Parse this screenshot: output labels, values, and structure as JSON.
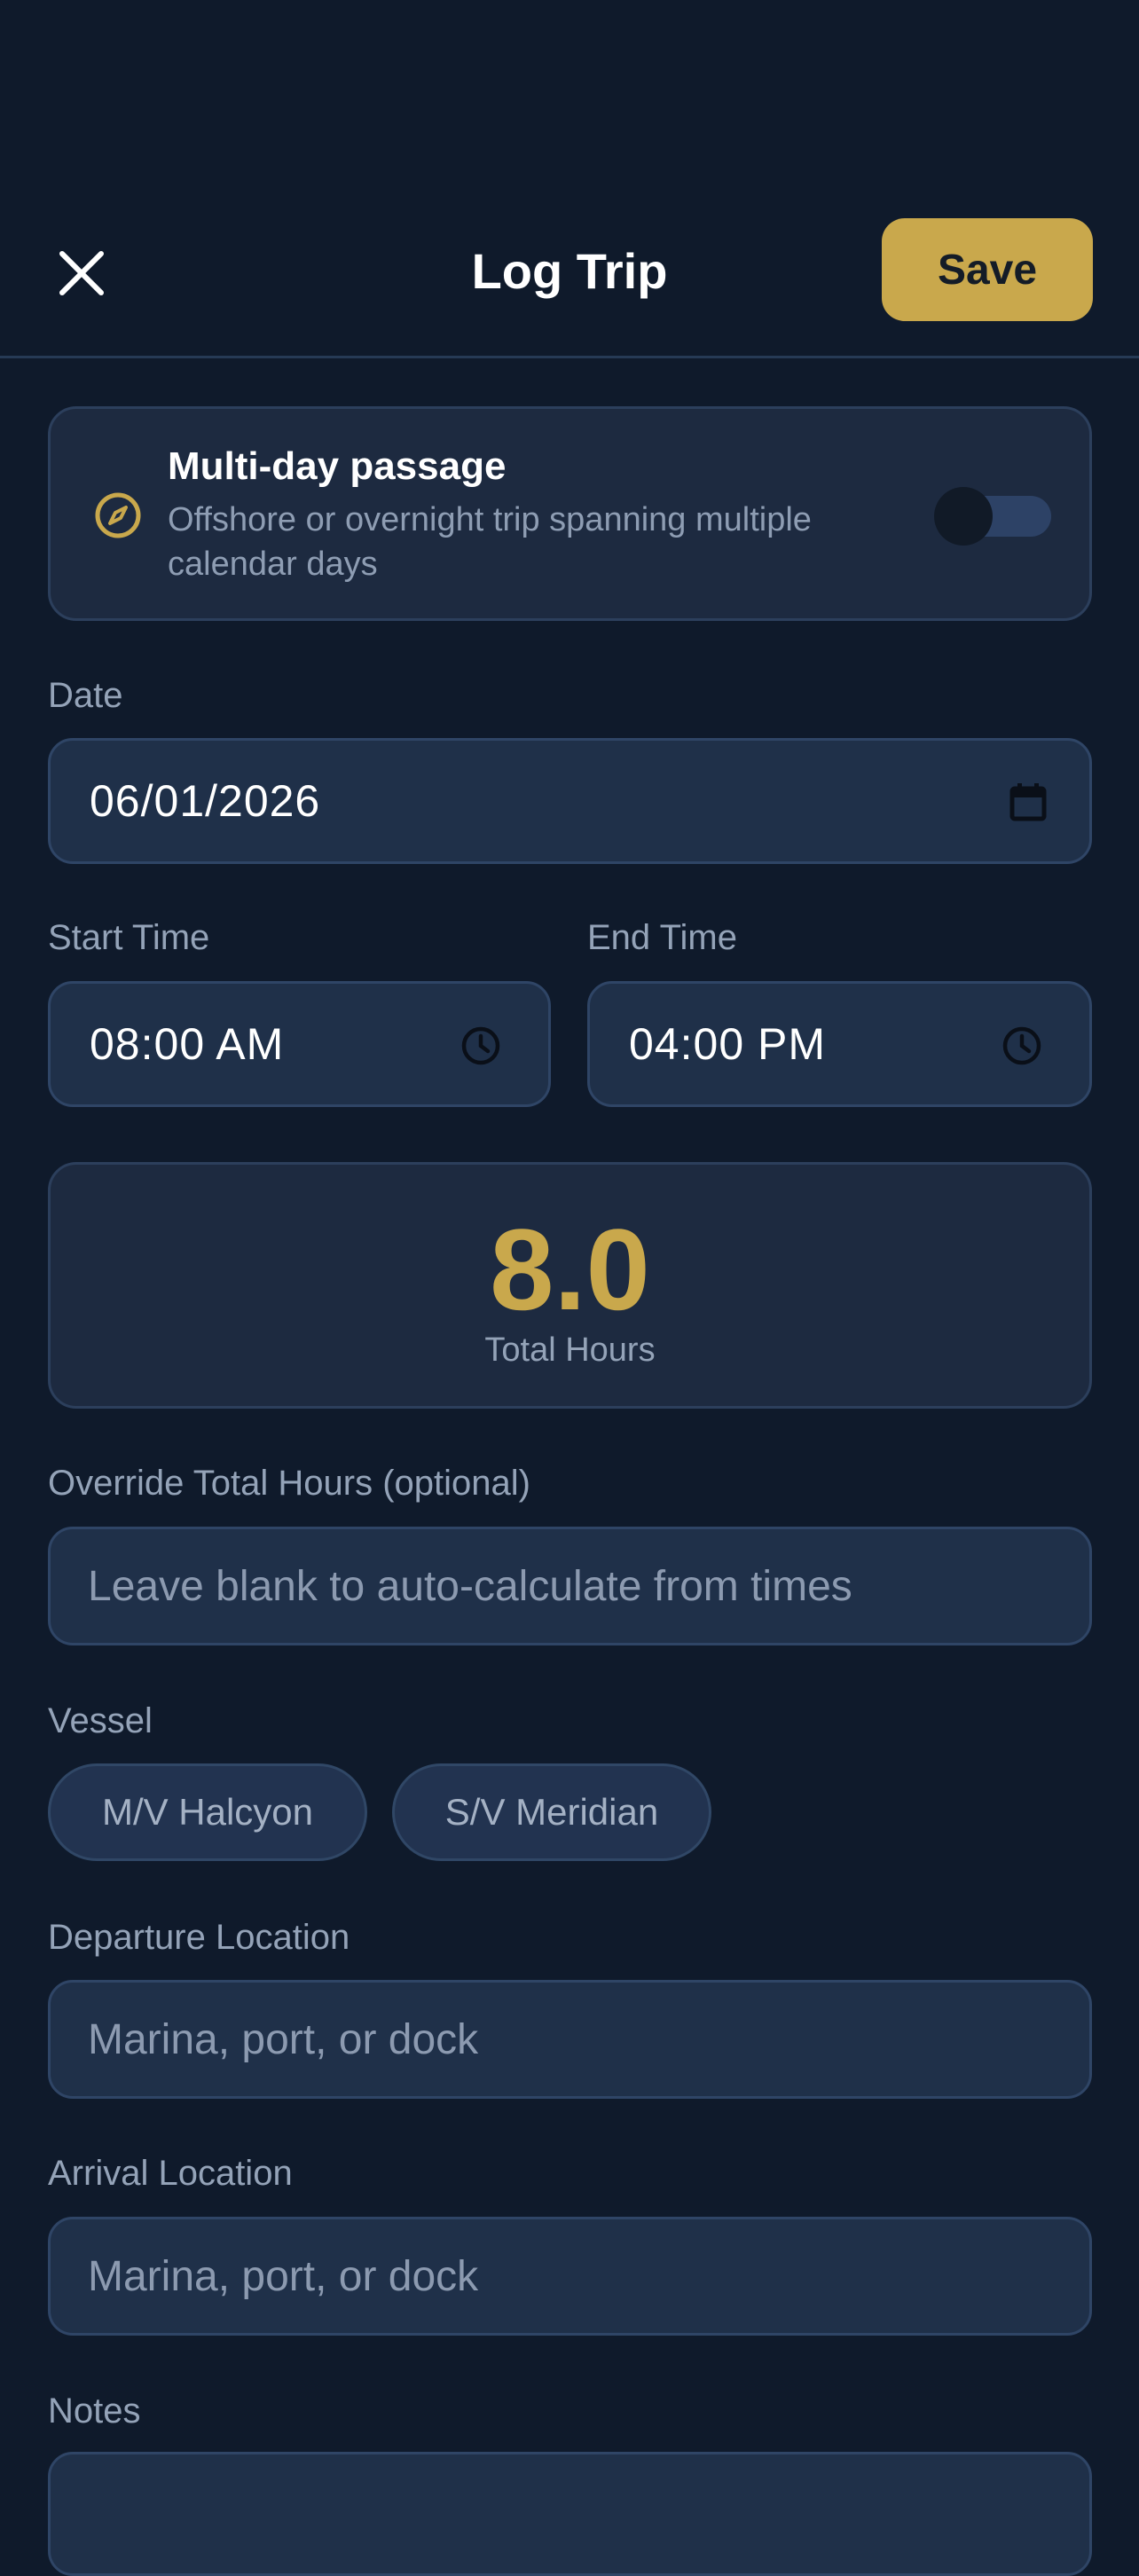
{
  "header": {
    "title": "Log Trip",
    "save_label": "Save",
    "close_icon": "close-icon"
  },
  "passage": {
    "title": "Multi-day passage",
    "subtitle": "Offshore or overnight trip spanning multiple calendar days",
    "enabled": false,
    "icon": "compass-icon"
  },
  "date": {
    "label": "Date",
    "value": "06/01/2026",
    "icon": "calendar-icon"
  },
  "start_time": {
    "label": "Start Time",
    "value": "08:00 AM",
    "icon": "clock-icon"
  },
  "end_time": {
    "label": "End Time",
    "value": "04:00 PM",
    "icon": "clock-icon"
  },
  "total_hours": {
    "value": "8.0",
    "label": "Total Hours"
  },
  "override": {
    "label": "Override Total Hours (optional)",
    "placeholder": "Leave blank to auto-calculate from times",
    "value": ""
  },
  "vessel": {
    "label": "Vessel",
    "options": [
      "M/V Halcyon",
      "S/V Meridian"
    ]
  },
  "departure": {
    "label": "Departure Location",
    "placeholder": "Marina, port, or dock",
    "value": ""
  },
  "arrival": {
    "label": "Arrival Location",
    "placeholder": "Marina, port, or dock",
    "value": ""
  },
  "notes": {
    "label": "Notes"
  },
  "colors": {
    "background": "#0f1a2b",
    "accent": "#c9a84c",
    "card": "#1d2a40",
    "field": "#1f3049"
  }
}
